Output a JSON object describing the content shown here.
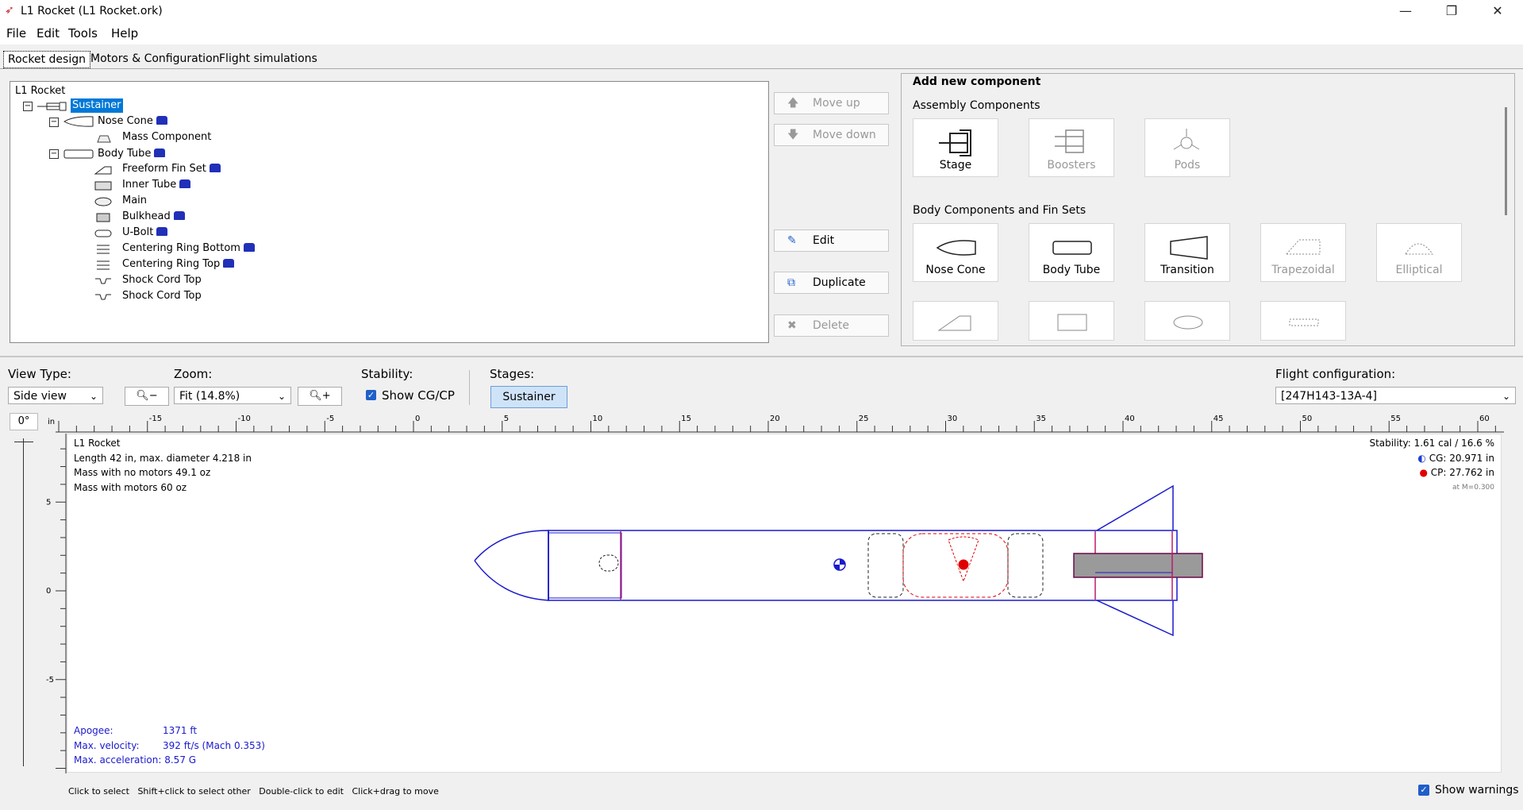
{
  "window": {
    "title": "L1 Rocket (L1 Rocket.ork)",
    "minimize_glyph": "—",
    "maximize_glyph": "❐",
    "close_glyph": "✕"
  },
  "menu": [
    "File",
    "Edit",
    "Tools",
    "Help"
  ],
  "tabs": [
    "Rocket design",
    "Motors & Configuration",
    "Flight simulations"
  ],
  "tree": {
    "root": "L1 Rocket",
    "stage": "Sustainer",
    "items": [
      {
        "label": "Nose Cone",
        "lock": true
      },
      {
        "label": "Mass Component",
        "lock": false
      },
      {
        "label": "Body Tube",
        "lock": true
      },
      {
        "label": "Freeform Fin Set",
        "lock": true
      },
      {
        "label": "Inner Tube",
        "lock": true
      },
      {
        "label": "Main",
        "lock": false
      },
      {
        "label": "Bulkhead",
        "lock": true
      },
      {
        "label": "U-Bolt",
        "lock": true
      },
      {
        "label": "Centering Ring Bottom",
        "lock": true
      },
      {
        "label": "Centering Ring Top",
        "lock": true
      },
      {
        "label": "Shock Cord Top",
        "lock": false
      },
      {
        "label": "Shock Cord Top",
        "lock": false
      }
    ]
  },
  "actions": {
    "move_up": "Move up",
    "move_down": "Move down",
    "edit": "Edit",
    "duplicate": "Duplicate",
    "delete": "Delete"
  },
  "add_component": {
    "title": "Add new component",
    "assembly_header": "Assembly Components",
    "assembly": [
      {
        "label": "Stage",
        "enabled": true
      },
      {
        "label": "Boosters",
        "enabled": false
      },
      {
        "label": "Pods",
        "enabled": false
      }
    ],
    "body_header": "Body Components and Fin Sets",
    "body": [
      {
        "label": "Nose Cone",
        "enabled": true
      },
      {
        "label": "Body Tube",
        "enabled": true
      },
      {
        "label": "Transition",
        "enabled": true
      },
      {
        "label": "Trapezoidal",
        "enabled": false
      },
      {
        "label": "Elliptical",
        "enabled": false
      }
    ]
  },
  "view_controls": {
    "view_type_label": "View Type:",
    "view_type_value": "Side view",
    "zoom_label": "Zoom:",
    "zoom_value": "Fit (14.8%)",
    "stability_label": "Stability:",
    "show_cgcp": "Show CG/CP",
    "stages_label": "Stages:",
    "stage_button": "Sustainer",
    "flight_config_label": "Flight configuration:",
    "flight_config_value": "[247H143-13A-4]",
    "angle": "0°",
    "unit": "in"
  },
  "ruler": {
    "h_labels": [
      "-15",
      "-10",
      "-5",
      "0",
      "5",
      "10",
      "15",
      "20",
      "25",
      "30",
      "35",
      "40",
      "45",
      "50",
      "55",
      "60"
    ],
    "v_labels": [
      "5",
      "0",
      "-5"
    ]
  },
  "figure_info": {
    "name": "L1 Rocket",
    "length": "Length 42 in, max. diameter 4.218 in",
    "mass_no_motors": "Mass with no motors 49.1 oz",
    "mass_with_motors": "Mass with motors 60 oz",
    "stability": "Stability: 1.61 cal / 16.6 %",
    "cg": "CG: 20.971 in",
    "cp": "CP: 27.762 in",
    "mach": "at M=0.300"
  },
  "sim": {
    "apogee_label": "Apogee:",
    "apogee_value": "1371 ft",
    "vel_label": "Max. velocity:",
    "vel_value": "392 ft/s  (Mach 0.353)",
    "acc_label": "Max. acceleration:",
    "acc_value": "8.57 G"
  },
  "status_bar": {
    "hints": [
      "Click to select",
      "Shift+click to select other",
      "Double-click to edit",
      "Click+drag to move"
    ],
    "show_warnings": "Show warnings"
  },
  "colors": {
    "accent": "#1f5fc9",
    "selection": "#0078d7",
    "rocket_outline": "#1a1acc",
    "cp_red": "#e00000",
    "lock_blue": "#2030b8"
  }
}
